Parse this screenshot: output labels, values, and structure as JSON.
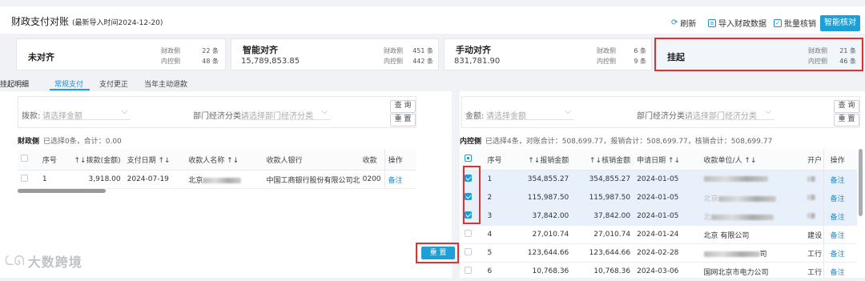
{
  "header": {
    "title": "财政支付对账",
    "import_time": "(最新导入时间2024-12-20)",
    "actions": {
      "refresh": "刷新",
      "import": "导入财政数据",
      "batch": "批量核销",
      "smart": "智能核对"
    }
  },
  "cards": [
    {
      "title": "未对齐",
      "value": "",
      "l1": "财政侧",
      "n1": "22 条",
      "l2": "内控侧",
      "n2": "48 条"
    },
    {
      "title": "智能对齐",
      "value": "15,789,853.85",
      "l1": "财政侧",
      "n1": "451 条",
      "l2": "内控侧",
      "n2": "442 条"
    },
    {
      "title": "手动对齐",
      "value": "831,781.90",
      "l1": "财政侧",
      "n1": "6 条",
      "l2": "内控侧",
      "n2": "9 条"
    },
    {
      "title": "挂起",
      "value": "",
      "l1": "财政侧",
      "n1": "21 条",
      "l2": "内控侧",
      "n2": "46 条"
    }
  ],
  "tabs": {
    "label": "挂起明细",
    "items": [
      "常规支付",
      "支付更正",
      "当年主动退款"
    ]
  },
  "left": {
    "filter1_label": "拨款:",
    "filter1_placeholder": "请选择金额",
    "filter2_label": "部门经济分类:",
    "filter2_placeholder": "请选择部门经济分类",
    "query": "查 询",
    "reset": "重 置",
    "side": "财政侧",
    "summary": "已选择0条，合计：0.00",
    "columns": [
      "序号",
      "↑↓拨款(金额)",
      "支付日期 ↑↓",
      "收款人名称 ↑↓",
      "收款人银行",
      "收款",
      "操作"
    ],
    "rows": [
      {
        "no": "1",
        "amount": "3,918.00",
        "date": "2024-07-19",
        "payee": "北京",
        "bank": "中国工商银行股份有限公司北京",
        "acct": "0200",
        "op": "备注"
      }
    ]
  },
  "center_reset": "重 置",
  "right": {
    "filter1_label": "金额:",
    "filter1_placeholder": "请选择金额",
    "filter2_label": "部门经济分类:",
    "filter2_placeholder": "请选择部门经济分类",
    "query": "查 询",
    "reset": "重 置",
    "side": "内控侧",
    "summary": "已选择4条，对账合计：508,699.77，报销合计：508,699.77，核销合计：508,699.77",
    "columns": [
      "序号",
      "↑↓报销金额",
      "↑↓核销金额",
      "申请日期 ↑↓",
      "收款单位/人 ↑↓",
      "开户",
      "操作"
    ],
    "rows": [
      {
        "no": "1",
        "a1": "354,855.27",
        "a2": "354,855.27",
        "date": "2024-01-05",
        "payee": "",
        "bank": "",
        "op": "备注",
        "checked": true
      },
      {
        "no": "2",
        "a1": "115,987.50",
        "a2": "115,987.50",
        "date": "2024-01-05",
        "payee": "北京",
        "bank": "",
        "op": "备注",
        "checked": true
      },
      {
        "no": "3",
        "a1": "37,842.00",
        "a2": "37,842.00",
        "date": "2024-01-05",
        "payee": "北",
        "bank": "",
        "op": "备注",
        "checked": true
      },
      {
        "no": "4",
        "a1": "27,010.74",
        "a2": "27,010.74",
        "date": "2024-01-24",
        "payee": "北京 有限公司",
        "bank": "建设",
        "op": "备注",
        "checked": false
      },
      {
        "no": "5",
        "a1": "123,644.66",
        "a2": "123,644.66",
        "date": "2024-02-28",
        "payee": "司",
        "bank": "工行",
        "op": "备注",
        "checked": false
      },
      {
        "no": "6",
        "a1": "10,768.36",
        "a2": "10,768.36",
        "date": "2024-03-06",
        "payee": "国网北京市电力公司",
        "bank": "工行",
        "op": "备注",
        "checked": false
      }
    ]
  },
  "watermark": "大数跨境",
  "colors": {
    "accent": "#1e9fd6",
    "highlight": "#e03030"
  }
}
